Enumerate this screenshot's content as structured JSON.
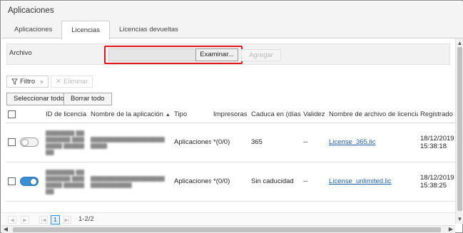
{
  "app": {
    "title": "Aplicaciones"
  },
  "tabs": [
    {
      "label": "Aplicaciones",
      "active": false
    },
    {
      "label": "Licencias",
      "active": true
    },
    {
      "label": "Licencias devueltas",
      "active": false
    }
  ],
  "file": {
    "label": "Archivo",
    "browse_label": "Examinar...",
    "add_label": "Agregar"
  },
  "toolbar": {
    "filter_label": "Filtro",
    "delete_label": "Eliminar",
    "select_all_label": "Seleccionar todo",
    "clear_all_label": "Borrar todo"
  },
  "columns": [
    "ID de licencia",
    "Nombre de la aplicación",
    "Tipo",
    "Impresoras",
    "Caduca en (días)",
    "Validez",
    "Nombre de archivo de licencia",
    "Registrado e"
  ],
  "rows": [
    {
      "enabled": false,
      "type": "Aplicaciones",
      "printers": "*(0/0)",
      "expires": "365",
      "validity": "--",
      "file": "License_365.lic",
      "date": "18/12/2019",
      "time": "15:38:18"
    },
    {
      "enabled": true,
      "type": "Aplicaciones",
      "printers": "*(0/0)",
      "expires": "Sin caducidad",
      "validity": "--",
      "file": "License_unlimited.lic",
      "date": "18/12/2019",
      "time": "15:38:25"
    }
  ],
  "pager": {
    "page": "1",
    "info": "1-2/2"
  },
  "colors": {
    "accent": "#3a8fd2",
    "highlight_outline": "#e3141b",
    "link": "#1f5faa"
  }
}
